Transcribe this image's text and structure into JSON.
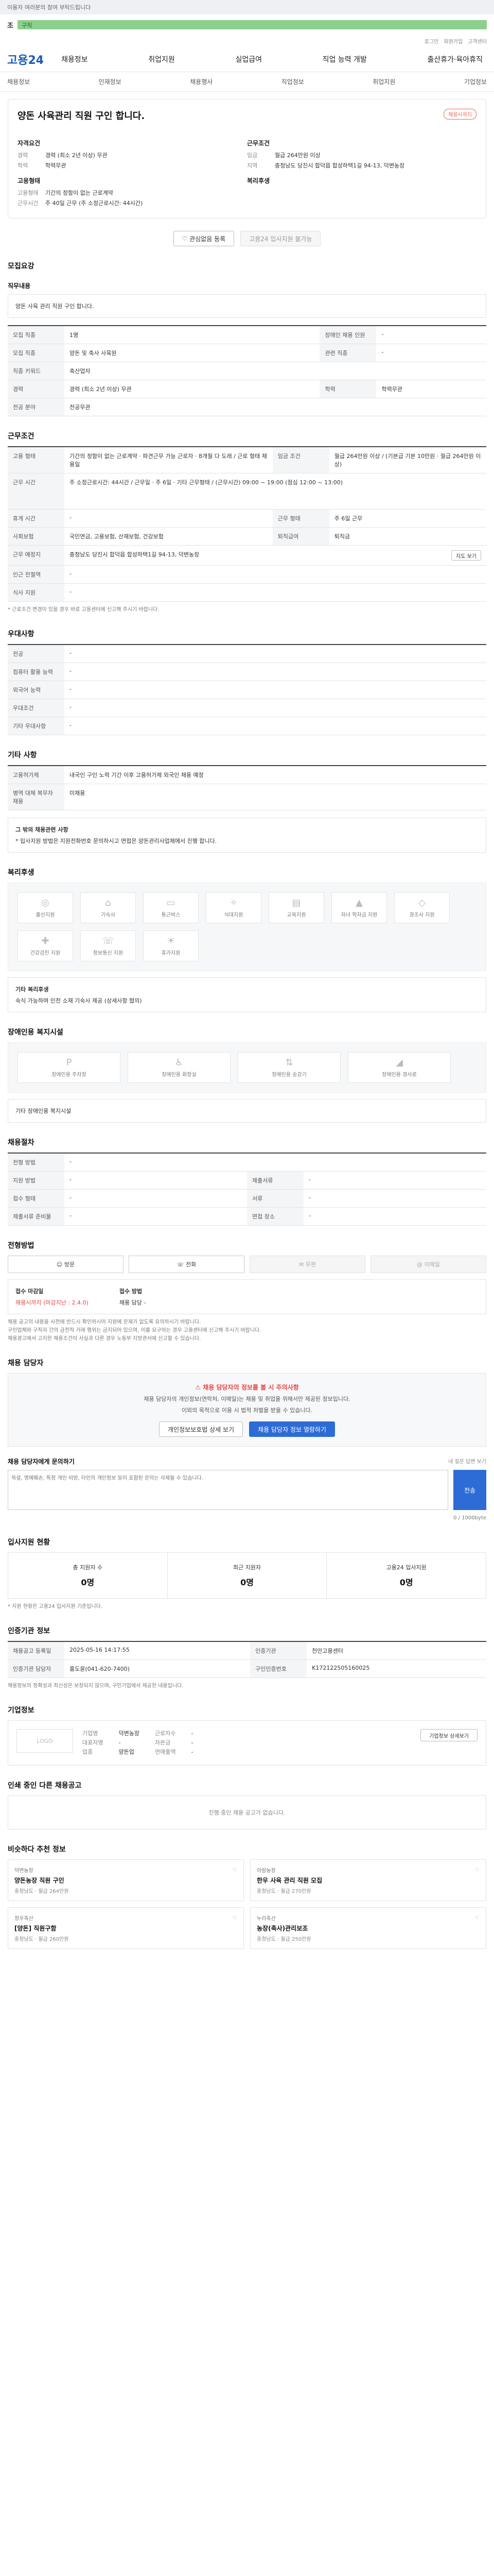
{
  "topbar": {
    "text": "이용자 여러분의 참여 부탁드립니다"
  },
  "toolbar": {
    "label": "조",
    "green_text": "구직"
  },
  "util": {
    "items": [
      "로그인",
      "회원가입",
      "고객센터"
    ]
  },
  "header": {
    "logo": "고용24",
    "gnb": [
      "채용정보",
      "취업지원",
      "실업급여",
      "직업 능력 개발",
      "출산휴가·육아휴직"
    ]
  },
  "lnb": [
    "채용정보",
    "인재정보",
    "채용행사",
    "직업정보",
    "취업지원",
    "기업정보"
  ],
  "job": {
    "title": "양돈 사육관리 직원 구인 합니다.",
    "badge": "채용시까지",
    "left_section": "자격요건",
    "left_kv": [
      {
        "k": "경력",
        "v": "경력 (최소 2년 이상) 무관"
      },
      {
        "k": "학력",
        "v": "학력무관"
      }
    ],
    "left_section2": "고용형태",
    "left_kv2": [
      {
        "k": "고용형태",
        "v": "기간의 정함이 없는 근로계약"
      },
      {
        "k": "근무시간",
        "v": "주 40일 근무 (주 소정근로시간: 44시간)"
      }
    ],
    "right_section": "근무조건",
    "right_kv": [
      {
        "k": "임금",
        "v": "월급 264만원 이상"
      },
      {
        "k": "지역",
        "v": "충청남도 당진시 합덕읍 합성하택1길 94-13, 덕변농장"
      }
    ],
    "right_section2": "복리후생",
    "btn_scrap": "관심없음 등록",
    "btn_apply": "고용24 입사지원 불가능"
  },
  "sections": {
    "recruit_title": "모집요강",
    "duty_title": "직무내용",
    "duty_text": "양돈 사육 관리 직원 구인 합니다.",
    "recruit_rows": [
      {
        "k": "모집 직종",
        "v": "1명",
        "k2": "장애인 채용 인원",
        "v2": "-"
      },
      {
        "k": "모집 직종",
        "v": "양돈 및 축사 사육원",
        "k2": "관련 직종",
        "v2": "-"
      },
      {
        "k": "직종 키워드",
        "v": "축산업자",
        "k2": "",
        "v2": ""
      },
      {
        "k": "경력",
        "v": "경력 (최소 2년 이상) 무관",
        "k2": "학력",
        "v2": "학력무관"
      },
      {
        "k": "전공 분야",
        "v": "전공무관",
        "k2": "",
        "v2": ""
      }
    ],
    "cond_title": "근무조건",
    "cond_rows": [
      {
        "k": "고용 형태",
        "v": "기간의 정함이 없는 근로계약 · 파견근무 가능 근로자 · 8개월 다 도래 / 근로 형태 채용일",
        "k2": "임금 조건",
        "v2": "월급 264만원 이상 / (기본급 기본 10만원 · 월급 264만원 이상)"
      },
      {
        "k": "근무 시간",
        "v": "주 소정근로시간: 44시간 / 근무일 · 주 6일 · 기타 근무형태 / (근무시간) 09:00 ~ 19:00 (점심 12:00 ~ 13:00)",
        "k2": "",
        "v2": ""
      },
      {
        "k": "휴게 시간",
        "v": "-",
        "k2": "근무 형태",
        "v2": "주 6일 근무"
      },
      {
        "k": "사회보험",
        "v": "국민연금, 고용보험, 산재보험, 건강보험",
        "k2": "퇴직급여",
        "v2": "퇴직금"
      },
      {
        "k": "근무 예정지",
        "v": "충청남도 당진시 합덕읍 합성하택1길 94-13, 덕변농장",
        "k2": "",
        "v2": ""
      },
      {
        "k": "인근 전철역",
        "v": "-",
        "k2": "",
        "v2": ""
      },
      {
        "k": "식사 지원",
        "v": "-",
        "k2": "",
        "v2": ""
      }
    ],
    "map_btn": "지도 보기",
    "cond_note": "* 근로조건 변경이 있을 경우 바로 고용센터에 신고해 주시기 바랍니다.",
    "pref_title": "우대사항",
    "pref_rows": [
      {
        "k": "전공",
        "v": "-"
      },
      {
        "k": "컴퓨터 활용 능력",
        "v": "-"
      },
      {
        "k": "외국어 능력",
        "v": "-"
      },
      {
        "k": "우대조건",
        "v": "-"
      },
      {
        "k": "기타 우대사항",
        "v": "-"
      }
    ],
    "other_title": "기타 사항",
    "other_rows": [
      {
        "k": "고용허가제",
        "v": "내국인 구인 노력 기간 이후 고용허가제 외국인 채용 예정"
      },
      {
        "k": "병역 대체 복무자 채용",
        "v": "미채용"
      }
    ],
    "other_box_title": "그 밖의 채용관련 사항",
    "other_box_text": "* 입사지원 방법은 지원전화번호 문의하시고 면접은 양돈관리사업체에서 진행 합니다.",
    "benefit_title": "복리후생",
    "benefits": [
      "출산지원",
      "기숙사",
      "통근버스",
      "식대지원",
      "교육지원",
      "자녀 학자금 지원",
      "경조사 지원",
      "건강검진 지원",
      "정보통신 지원",
      "휴가지원"
    ],
    "benefit_etc_title": "기타 복리후생",
    "benefit_etc_text": "숙식 가능하며 인천 소재 기숙사 제공 (상세사항 협의)",
    "disability_title": "장애인용 복지시설",
    "disability_items": [
      "장애인용 주차장",
      "장애인용 화장실",
      "장애인용 승강기",
      "장애인용 경사로"
    ],
    "disability_etc": "기타 장애인용 복지시설",
    "apply_title": "채용절차",
    "apply_rows": [
      {
        "k": "전형 방법",
        "v": "-"
      },
      {
        "k": "지원 방법",
        "v": "-",
        "k2": "제출서류",
        "v2": "-"
      },
      {
        "k": "접수 형태",
        "v": "-",
        "k2": "서류",
        "v2": "-"
      },
      {
        "k": "제출서류 준비물",
        "v": "-",
        "k2": "면접 장소",
        "v2": "-"
      }
    ],
    "method_title": "전형방법",
    "methods": [
      "방문",
      "전화",
      "우편",
      "이메일"
    ],
    "period_title": "접수 마감일",
    "period_text": "채용시까지 (마감지난 : 2.4.0)",
    "contact_title": "접수 방법",
    "contact_text": "채용 담당 -",
    "notes_apply": [
      "채용 공고의 내용을 사전에 반드시 확인하시어 지원에 문제가 없도록 유의하시기 바랍니다.",
      "구인업체와 구직자 간의 금전적 거래 행위는 금지되어 있으며, 이를 요구하는 경우 고용센터에 신고해 주시기 바랍니다.",
      "채용광고에서 고지한 채용조건이 사실과 다른 경우 노동부 지방관서에 신고할 수 있습니다."
    ],
    "phone_title": "채용 담당자",
    "phone_alert": "채용 담당자의 정보를 볼 시 주의사항",
    "phone_text": "채용 담당자의 개인정보(연락처, 이메일)는 채용 및 취업을 위해서만 제공된 정보입니다.",
    "phone_text2": "이외의 목적으로 이용 시 법적 처벌을 받을 수 있습니다.",
    "phone_btn1": "개인정보보호법 상세 보기",
    "phone_btn2": "채용 담당자 정보 열람하기",
    "qa_title": "채용 담당자에게 문의하기",
    "qa_link": "내 질문 답변 보기",
    "qa_placeholder": "욕설, 명예훼손, 특정 개인 비방, 타인의 개인정보 등이 포함된 문의는 삭제될 수 있습니다.",
    "qa_count": "0 / 1000byte",
    "qa_submit": "전송",
    "status_title": "입사지원 현황",
    "status": [
      {
        "label": "총 지원자 수",
        "n": "0명"
      },
      {
        "label": "최근 지원자",
        "n": "0명"
      },
      {
        "label": "고용24 입사지원",
        "n": "0명"
      }
    ],
    "status_note": "* 지원 현황은 고용24 입사지원 기준입니다.",
    "agency_title": "인증기관 정보",
    "agency_rows": [
      {
        "k": "채용공고 등록일",
        "v": "2025-05-16 14:17:55",
        "k2": "인증기관",
        "v2": "천안고용센터"
      },
      {
        "k": "인증기관 담당자",
        "v": "홍도윤(041-620-7400)",
        "k2": "구인인증번호",
        "v2": "K172122505160025"
      }
    ],
    "agency_note": "채용정보의 정확성과 최신성은 보장되지 않으며, 구인기업에서 제공한 내용입니다.",
    "company_title": "기업정보",
    "company_logo": "LOGO",
    "company_cols": [
      [
        "기업명",
        "대표자명",
        "업종"
      ],
      [
        "덕변농장",
        "-",
        "양돈업"
      ],
      [
        "근로자수",
        "자본금",
        "연매출액"
      ],
      [
        "-",
        "-",
        "-"
      ]
    ],
    "company_btn": "기업정보 상세보기",
    "same_title": "인쇄 중인 다른 채용공고",
    "same_empty": "진행 중인 채용 공고가 없습니다.",
    "rec_title": "비슷하다 추천 정보",
    "recs": [
      {
        "co": "덕변농장",
        "tt": "양돈농장 직원 구인",
        "meta": "충청남도 · 월급 264만원"
      },
      {
        "co": "아람농장",
        "tt": "한우 사육 관리 직원 모집",
        "meta": "충청남도 · 월급 270만원"
      },
      {
        "co": "청우축산",
        "tt": "[양돈] 직원구함",
        "meta": "충청남도 · 월급 260만원"
      },
      {
        "co": "누리축산",
        "tt": "농장(축사)관리보조",
        "meta": "충청남도 · 월급 250만원"
      }
    ]
  }
}
